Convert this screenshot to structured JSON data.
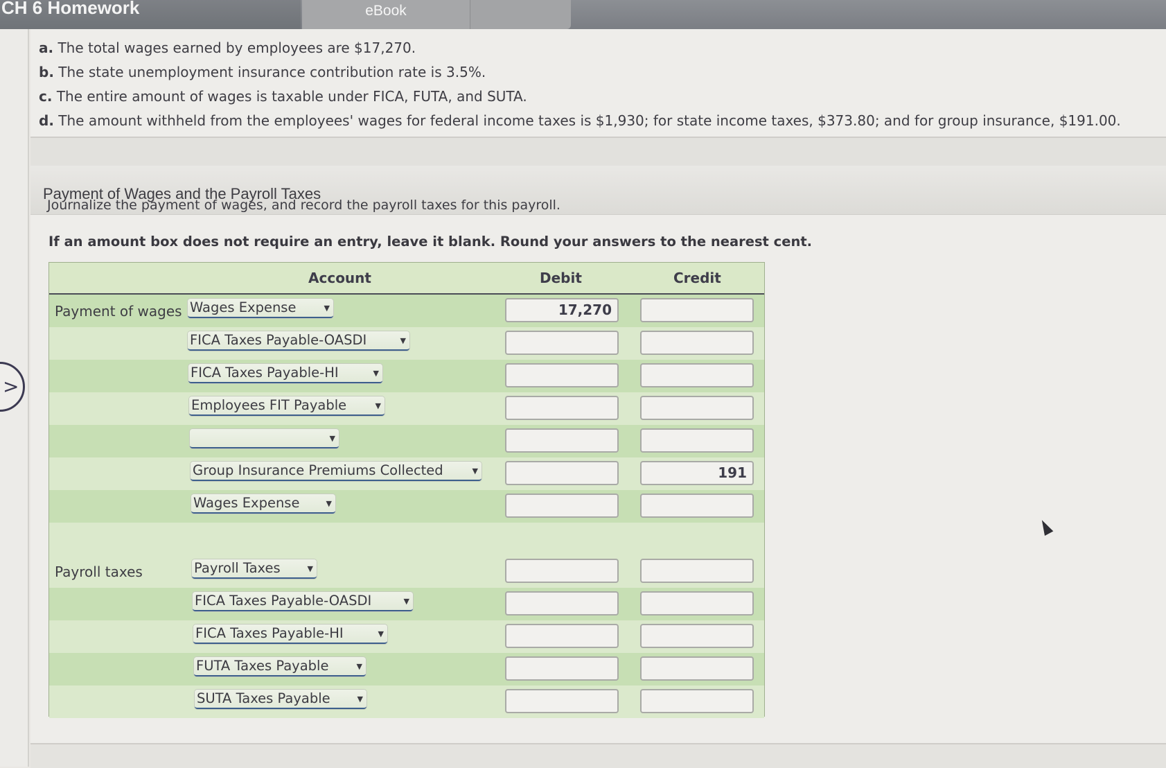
{
  "header": {
    "title": "CH 6 Homework",
    "tabs": [
      {
        "label": "eBook"
      }
    ]
  },
  "facts": [
    {
      "letter": "a.",
      "text": "The total wages earned by employees are $17,270."
    },
    {
      "letter": "b.",
      "text": "The state unemployment insurance contribution rate is 3.5%."
    },
    {
      "letter": "c.",
      "text": "The entire amount of wages is taxable under FICA, FUTA, and SUTA."
    },
    {
      "letter": "d.",
      "text": "The amount withheld from the employees' wages for federal income taxes is $1,930; for state income taxes, $373.80; and for group insurance, $191.00."
    }
  ],
  "section": {
    "title": "Payment of Wages and the Payroll Taxes",
    "instruction": "Journalize the payment of wages, and record the payroll taxes for this payroll.",
    "instruction_bold": "If an amount box does not require an entry, leave it blank. Round your answers to the nearest cent."
  },
  "journal": {
    "headers": {
      "account": "Account",
      "debit": "Debit",
      "credit": "Credit"
    },
    "rows": [
      {
        "label": "Payment of wages",
        "account": "Wages Expense",
        "debit": "17,270",
        "credit": ""
      },
      {
        "label": "",
        "account": "FICA Taxes Payable-OASDI",
        "debit": "",
        "credit": ""
      },
      {
        "label": "",
        "account": "FICA Taxes Payable-HI",
        "debit": "",
        "credit": ""
      },
      {
        "label": "",
        "account": "Employees FIT Payable",
        "debit": "",
        "credit": ""
      },
      {
        "label": "",
        "account": "",
        "debit": "",
        "credit": ""
      },
      {
        "label": "",
        "account": "Group Insurance Premiums Collected",
        "debit": "",
        "credit": "191"
      },
      {
        "label": "",
        "account": "Wages Expense",
        "debit": "",
        "credit": ""
      },
      {
        "label": "Payroll taxes",
        "account": "Payroll Taxes",
        "debit": "",
        "credit": ""
      },
      {
        "label": "",
        "account": "FICA Taxes Payable-OASDI",
        "debit": "",
        "credit": ""
      },
      {
        "label": "",
        "account": "FICA Taxes Payable-HI",
        "debit": "",
        "credit": ""
      },
      {
        "label": "",
        "account": "FUTA Taxes Payable",
        "debit": "",
        "credit": ""
      },
      {
        "label": "",
        "account": "SUTA Taxes Payable",
        "debit": "",
        "credit": ""
      }
    ]
  },
  "icons": {
    "nav": "chevron-right-icon",
    "dropdown": "caret-down-icon",
    "pointer": "mouse-pointer-icon"
  }
}
